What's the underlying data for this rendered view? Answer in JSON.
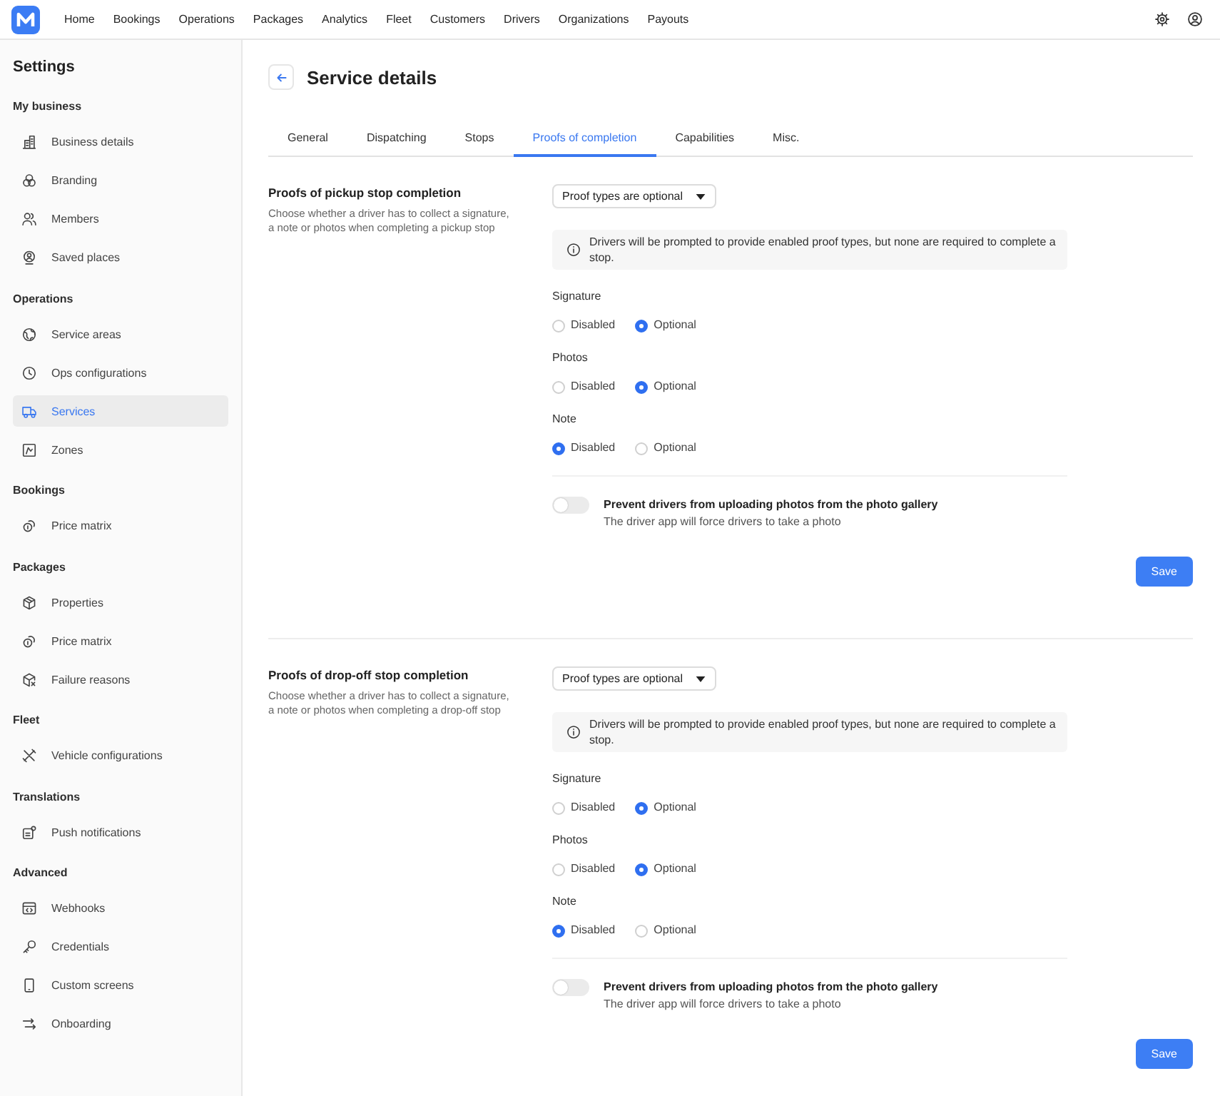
{
  "top_nav": {
    "items": [
      "Home",
      "Bookings",
      "Operations",
      "Packages",
      "Analytics",
      "Fleet",
      "Customers",
      "Drivers",
      "Organizations",
      "Payouts"
    ]
  },
  "sidebar": {
    "title": "Settings",
    "groups": [
      {
        "heading": "My business",
        "items": [
          {
            "label": "Business details",
            "kind": "building",
            "selected": false
          },
          {
            "label": "Branding",
            "kind": "circles",
            "selected": false
          },
          {
            "label": "Members",
            "kind": "users",
            "selected": false
          },
          {
            "label": "Saved places",
            "kind": "pin",
            "selected": false
          }
        ]
      },
      {
        "heading": "Operations",
        "items": [
          {
            "label": "Service areas",
            "kind": "globe",
            "selected": false
          },
          {
            "label": "Ops configurations",
            "kind": "clock",
            "selected": false
          },
          {
            "label": "Services",
            "kind": "truck",
            "selected": true
          },
          {
            "label": "Zones",
            "kind": "polygon",
            "selected": false
          }
        ]
      },
      {
        "heading": "Bookings",
        "items": [
          {
            "label": "Price matrix",
            "kind": "coins",
            "selected": false
          }
        ]
      },
      {
        "heading": "Packages",
        "items": [
          {
            "label": "Properties",
            "kind": "cube",
            "selected": false
          },
          {
            "label": "Price matrix",
            "kind": "coins",
            "selected": false
          },
          {
            "label": "Failure reasons",
            "kind": "cubex",
            "selected": false
          }
        ]
      },
      {
        "heading": "Fleet",
        "items": [
          {
            "label": "Vehicle configurations",
            "kind": "tools",
            "selected": false
          }
        ]
      },
      {
        "heading": "Translations",
        "items": [
          {
            "label": "Push notifications",
            "kind": "badge",
            "selected": false
          }
        ]
      },
      {
        "heading": "Advanced",
        "items": [
          {
            "label": "Webhooks",
            "kind": "code",
            "selected": false
          },
          {
            "label": "Credentials",
            "kind": "key",
            "selected": false
          },
          {
            "label": "Custom screens",
            "kind": "mobile",
            "selected": false
          },
          {
            "label": "Onboarding",
            "kind": "arrows",
            "selected": false
          }
        ]
      }
    ]
  },
  "main": {
    "title": "Service details",
    "tabs": [
      {
        "label": "General",
        "selected": false
      },
      {
        "label": "Dispatching",
        "selected": false
      },
      {
        "label": "Stops",
        "selected": false
      },
      {
        "label": "Proofs of completion",
        "selected": true
      },
      {
        "label": "Capabilities",
        "selected": false
      },
      {
        "label": "Misc.",
        "selected": false
      }
    ],
    "sections": [
      {
        "title": "Proofs of pickup stop completion",
        "description": "Choose whether a driver has to collect a signature, a note or photos when completing a pickup stop",
        "dropdown": {
          "value": "Proof types are optional"
        },
        "info": "Drivers will be prompted to provide enabled proof types, but none are required to complete a stop.",
        "proof_types": [
          {
            "label": "Signature",
            "options": [
              {
                "label": "Disabled",
                "selected": false
              },
              {
                "label": "Optional",
                "selected": true
              }
            ]
          },
          {
            "label": "Photos",
            "options": [
              {
                "label": "Disabled",
                "selected": false
              },
              {
                "label": "Optional",
                "selected": true
              }
            ]
          },
          {
            "label": "Note",
            "options": [
              {
                "label": "Disabled",
                "selected": true
              },
              {
                "label": "Optional",
                "selected": false
              }
            ]
          }
        ],
        "toggle": {
          "on": false,
          "label": "Prevent drivers from uploading photos from the photo gallery",
          "description": "The driver app will force drivers to take a photo"
        },
        "save_button": "Save"
      },
      {
        "title": "Proofs of drop-off stop completion",
        "description": "Choose whether a driver has to collect a signature, a note or photos when completing a drop-off stop",
        "dropdown": {
          "value": "Proof types are optional"
        },
        "info": "Drivers will be prompted to provide enabled proof types, but none are required to complete a stop.",
        "proof_types": [
          {
            "label": "Signature",
            "options": [
              {
                "label": "Disabled",
                "selected": false
              },
              {
                "label": "Optional",
                "selected": true
              }
            ]
          },
          {
            "label": "Photos",
            "options": [
              {
                "label": "Disabled",
                "selected": false
              },
              {
                "label": "Optional",
                "selected": true
              }
            ]
          },
          {
            "label": "Note",
            "options": [
              {
                "label": "Disabled",
                "selected": true
              },
              {
                "label": "Optional",
                "selected": false
              }
            ]
          }
        ],
        "toggle": {
          "on": false,
          "label": "Prevent drivers from uploading photos from the photo gallery",
          "description": "The driver app will force drivers to take a photo"
        },
        "save_button": "Save"
      }
    ]
  }
}
